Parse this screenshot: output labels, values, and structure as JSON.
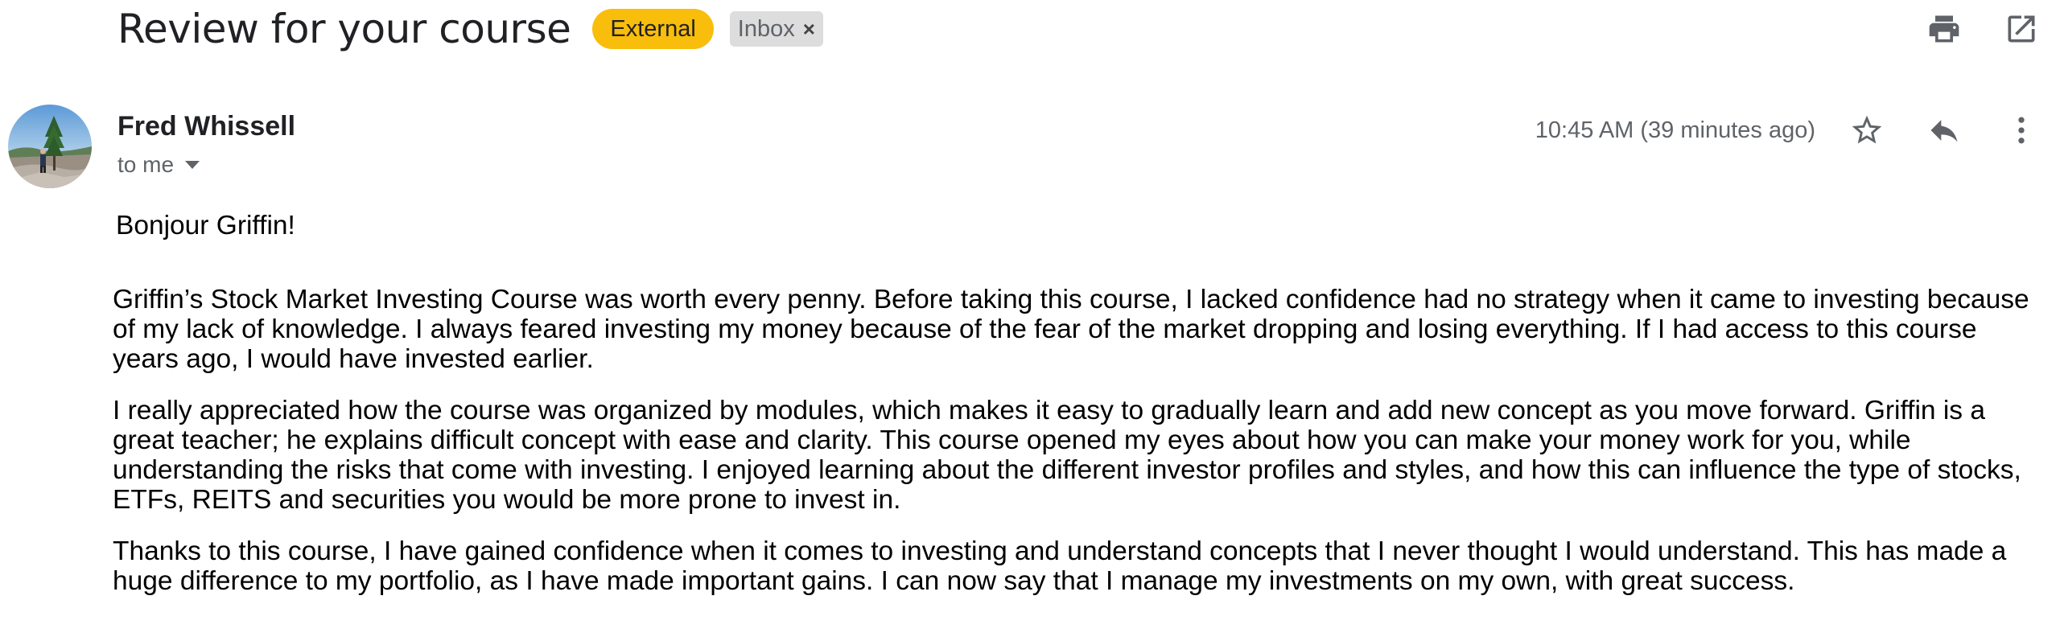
{
  "email": {
    "subject": "Review for your course",
    "labels": {
      "external": "External",
      "inbox": "Inbox",
      "inbox_remove": "×"
    },
    "sender": {
      "name": "Fred Whissell",
      "recipient_text": "to me"
    },
    "timestamp": "10:45 AM (39 minutes ago)",
    "body": {
      "greeting": "Bonjour Griffin!",
      "paragraphs": [
        "Griffin’s Stock Market Investing Course was worth every penny. Before taking this course, I lacked confidence had no strategy when it came to investing because of my lack of knowledge. I always feared investing my money because of the fear of the market dropping and losing everything. If I had access to this course years ago, I would have invested earlier.",
        "I really appreciated how the course was organized by modules, which makes it easy to gradually learn and add new concept as you move forward. Griffin is a great teacher; he explains difficult concept with ease and clarity. This course opened my eyes about how you can make your money work for you, while understanding the risks that come with investing. I enjoyed learning about the different investor profiles and styles, and how this can influence the type of stocks, ETFs, REITS and securities you would be more prone to invest in.",
        "Thanks to this course, I have gained confidence when it comes to investing and understand concepts that I never thought I would understand. This has made a huge difference to my portfolio, as I have made important gains. I can now say that I manage my investments on my own, with great success."
      ]
    }
  },
  "icons": {
    "print": "print-icon",
    "open_new_window": "open-in-new-window-icon",
    "star": "star-icon",
    "reply": "reply-icon",
    "more": "more-vertical-icon",
    "recipient_dropdown": "caret-down-icon"
  },
  "colors": {
    "external_badge": "#f9bd0b",
    "inbox_badge": "#dddddd",
    "icon": "#5f6368",
    "text": "#202124"
  }
}
